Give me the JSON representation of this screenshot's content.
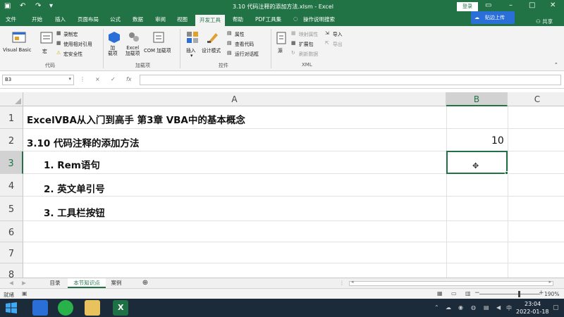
{
  "title": "3.10 代码注释的添加方法.xlsm - Excel",
  "login": "登录",
  "cloud_upload": "贴边上传",
  "share": "共享",
  "tabs": [
    "文件",
    "开始",
    "插入",
    "页面布局",
    "公式",
    "数据",
    "审阅",
    "视图",
    "开发工具",
    "帮助",
    "PDF工具集",
    "操作说明搜索"
  ],
  "ribbon": {
    "visual_basic": "Visual Basic",
    "macro": "宏",
    "record_macro": "录制宏",
    "relative_ref": "使用相对引用",
    "macro_security": "宏安全性",
    "group_code": "代码",
    "addins": "加\n载项",
    "excel_addins": "Excel\n加载项",
    "com_addins": "COM 加载项",
    "group_addins": "加载项",
    "insert": "插入",
    "design_mode": "设计模式",
    "properties": "属性",
    "view_code": "查看代码",
    "run_dialog": "运行对话框",
    "group_controls": "控件",
    "source": "源",
    "map_properties": "映射属性",
    "expansion_packs": "扩展包",
    "refresh_data": "刷新数据",
    "import": "导入",
    "export": "导出",
    "group_xml": "XML"
  },
  "formula_bar": {
    "name_box": "B3",
    "cancel": "×",
    "enter": "✓",
    "fx": "fx",
    "value": ""
  },
  "columns": [
    "A",
    "B",
    "C"
  ],
  "rows": [
    "1",
    "2",
    "3",
    "4",
    "5",
    "6",
    "7",
    "8"
  ],
  "cells": {
    "A1": "ExcelVBA从入门到高手 第3章 VBA中的基本概念",
    "A2": "3.10 代码注释的添加方法",
    "B2": "10",
    "A3": "1. Rem语句",
    "A4": "2. 英文单引号",
    "A5": "3. 工具栏按钮"
  },
  "sheets": [
    "目录",
    "本节知识点",
    "案例"
  ],
  "active_sheet": "本节知识点",
  "status": "就绪",
  "zoom": "190%",
  "clock": {
    "time": "23:04",
    "date": "2022-01-18"
  }
}
